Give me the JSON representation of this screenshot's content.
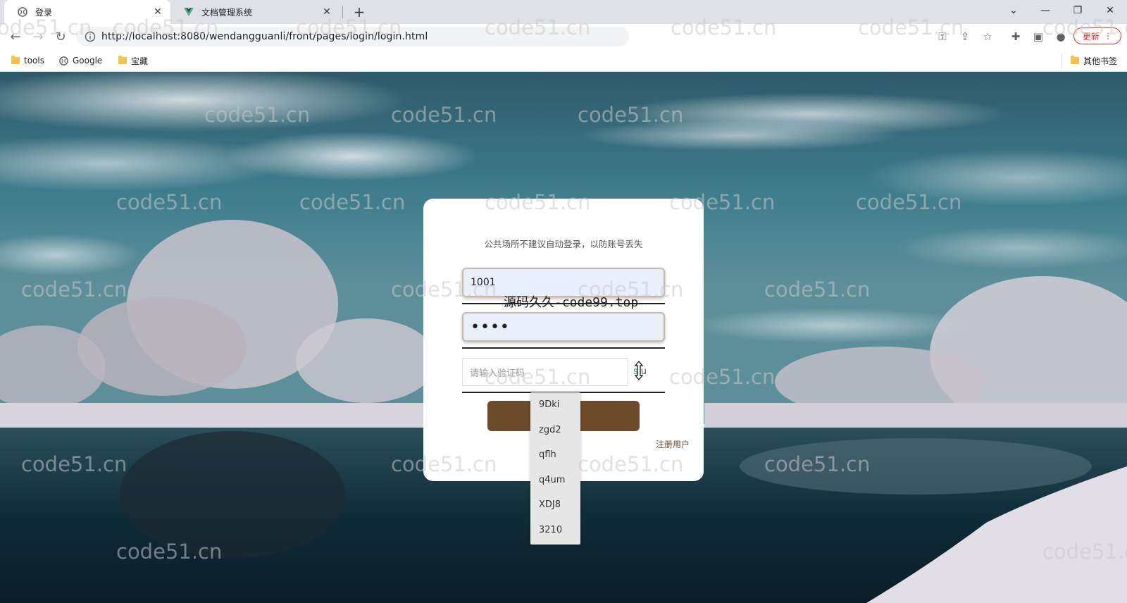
{
  "browser": {
    "tabs": [
      {
        "title": "登录",
        "active": true
      },
      {
        "title": "文档管理系统",
        "active": false
      }
    ],
    "url": "http://localhost:8080/wendangguanli/front/pages/login/login.html",
    "update_label": "更新",
    "bookmarks": [
      {
        "label": "tools",
        "icon": "folder-icon"
      },
      {
        "label": "Google",
        "icon": "globe-icon"
      },
      {
        "label": "宝藏",
        "icon": "folder-icon"
      }
    ],
    "other_bookmarks_label": "其他书签"
  },
  "login": {
    "notice": "公共场所不建议自动登录，以防账号丢失",
    "username_value": "1001",
    "password_value": "••••",
    "captcha_placeholder": "请输入验证码",
    "captcha_chars": [
      "s",
      "u"
    ],
    "register_label": "注册用户",
    "button_color": "#6b4b2b"
  },
  "overlay_text": "源码久久-code99.top",
  "watermark_text": "code51.cn",
  "autocomplete": {
    "options": [
      "9Dki",
      "zgd2",
      "qflh",
      "q4um",
      "XDJ8",
      "3210"
    ]
  }
}
